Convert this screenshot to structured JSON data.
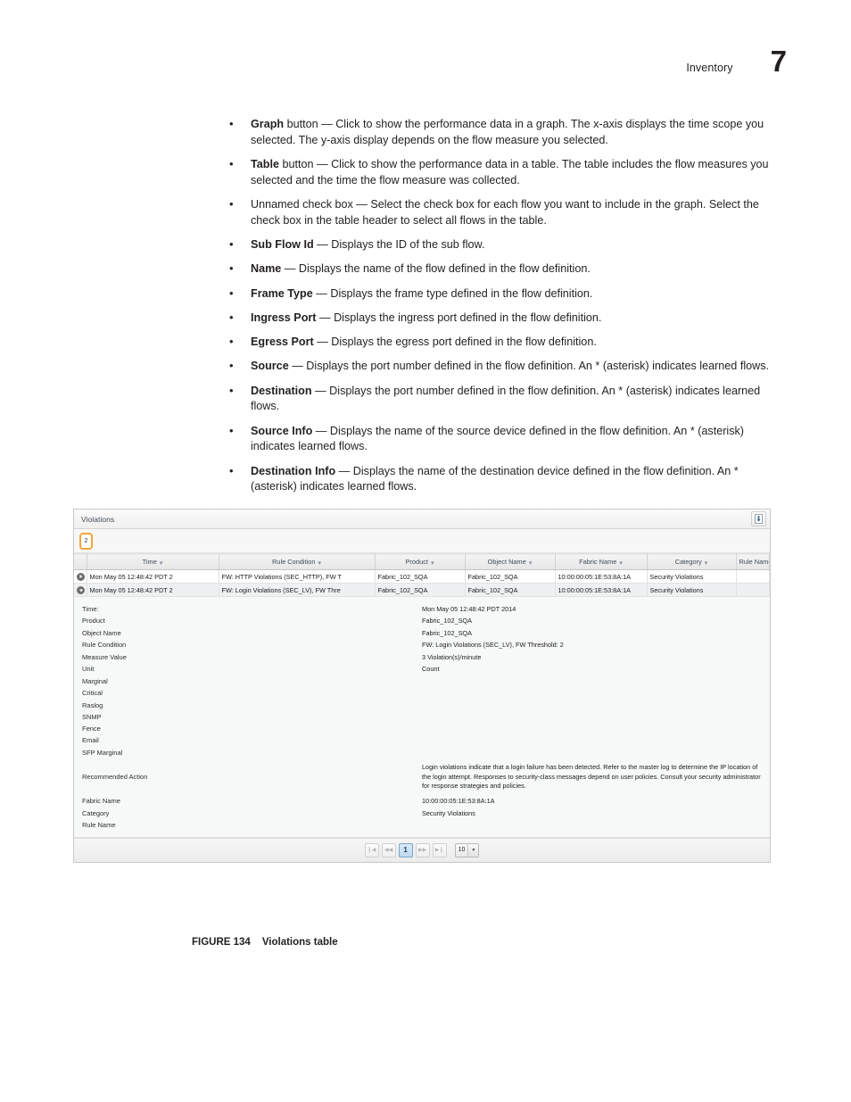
{
  "page_header": {
    "chapter_label": "Inventory",
    "chapter_number": "7"
  },
  "bullets": [
    {
      "term": "Graph",
      "rest": " button — Click to show the performance data in a graph. The x-axis displays the time scope you selected. The y-axis display depends on the flow measure you selected."
    },
    {
      "term": "Table",
      "rest": " button — Click to show the performance data in a table. The table includes the flow measures you selected and the time the flow measure was collected."
    },
    {
      "term": "",
      "rest": "Unnamed check box — Select the check box for each flow you want to include in the graph. Select the check box in the table header to select all flows in the table."
    },
    {
      "term": "Sub Flow Id",
      "rest": " — Displays the ID of the sub flow."
    },
    {
      "term": "Name",
      "rest": " — Displays the name of the flow defined in the flow definition."
    },
    {
      "term": "Frame Type",
      "rest": " — Displays the frame type defined in the flow definition."
    },
    {
      "term": "Ingress Port",
      "rest": " — Displays the ingress port defined in the flow definition."
    },
    {
      "term": "Egress Port",
      "rest": " — Displays the egress port defined in the flow definition."
    },
    {
      "term": "Source",
      "rest": " — Displays the port number defined in the flow definition. An * (asterisk) indicates learned flows."
    },
    {
      "term": "Destination",
      "rest": " — Displays the port number defined in the flow definition. An * (asterisk) indicates learned flows."
    },
    {
      "term": "Source Info",
      "rest": " — Displays the name of the source device defined in the flow definition. An * (asterisk) indicates learned flows."
    },
    {
      "term": "Destination Info",
      "rest": " — Displays the name of the destination device defined in the flow definition. An * (asterisk) indicates learned flows."
    }
  ],
  "screenshot": {
    "panel_title": "Violations",
    "export_icon": "export-download-icon",
    "count_badge": "2",
    "accent_color": "#f2a53c",
    "columns": [
      "Time",
      "Rule Condition",
      "Product",
      "Object Name",
      "Fabric Name",
      "Category",
      "Rule Name"
    ],
    "rows": [
      {
        "expanded": false,
        "time": "Mon May 05 12:48:42 PDT 2",
        "rule_condition": "FW: HTTP Violations (SEC_HTTP), FW T",
        "product": "Fabric_102_SQA",
        "object_name": "Fabric_102_SQA",
        "fabric_name": "10:00:00:05:1E:53:8A:1A",
        "category": "Security Violations",
        "rule_name": ""
      },
      {
        "expanded": true,
        "time": "Mon May 05 12:48:42 PDT 2",
        "rule_condition": "FW: Login Violations (SEC_LV), FW Thre",
        "product": "Fabric_102_SQA",
        "object_name": "Fabric_102_SQA",
        "fabric_name": "10:00:00:05:1E:53:8A:1A",
        "category": "Security Violations",
        "rule_name": ""
      }
    ],
    "detail": [
      {
        "label": "Time:",
        "value": "Mon May 05 12:48:42 PDT 2014"
      },
      {
        "label": "Product",
        "value": "Fabric_102_SQA"
      },
      {
        "label": "Object Name",
        "value": "Fabric_102_SQA"
      },
      {
        "label": "Rule Condition",
        "value": "FW: Login Violations (SEC_LV), FW Threshold: 2"
      },
      {
        "label": "Measure Value",
        "value": "3 Violation(s)/minute"
      },
      {
        "label": "Unit",
        "value": "Count"
      },
      {
        "label": "Marginal",
        "value": ""
      },
      {
        "label": "Critical",
        "value": ""
      },
      {
        "label": "Raslog",
        "value": ""
      },
      {
        "label": "SNMP",
        "value": ""
      },
      {
        "label": "Fence",
        "value": ""
      },
      {
        "label": "Email",
        "value": ""
      },
      {
        "label": "SFP Marginal",
        "value": ""
      },
      {
        "label": "Recommended Action",
        "value": "Login violations indicate that a login failure has been detected. Refer to the master log to determine the IP location of the login attempt. Responses to security-class messages depend on user policies. Consult your security administrator for response strategies and policies.",
        "multiline": true
      },
      {
        "label": "Fabric Name",
        "value": "10:00:00:05:1E:53:8A:1A"
      },
      {
        "label": "Category",
        "value": "Security Violations"
      },
      {
        "label": "Rule Name",
        "value": ""
      }
    ],
    "pagination": {
      "first_label": "❙◀",
      "prev_label": "◀◀",
      "current_page": "1",
      "next_label": "▶▶",
      "last_label": "▶❙",
      "page_size": "10",
      "caret": "▼"
    }
  },
  "figure_caption": {
    "number": "FIGURE 134",
    "title": "Violations table"
  }
}
